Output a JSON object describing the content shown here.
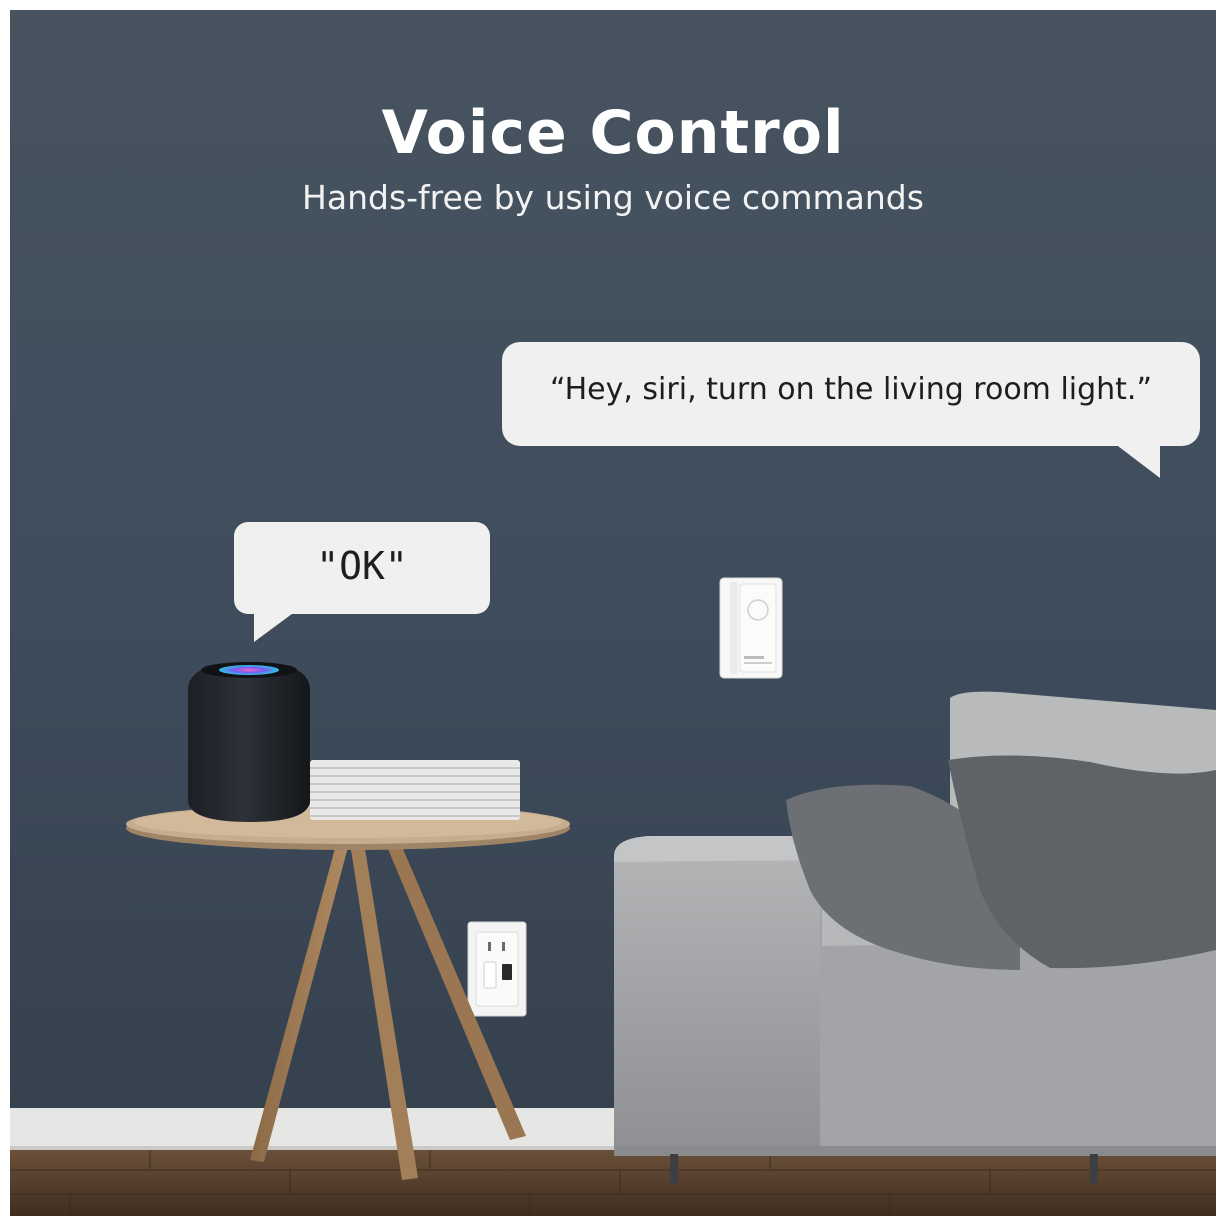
{
  "headline": {
    "title": "Voice Control",
    "subtitle": "Hands-free by using voice commands"
  },
  "speech_bubbles": {
    "user_command": "“Hey, siri, turn on the living room light.”",
    "speaker_reply": "\"OK\""
  },
  "colors": {
    "wall": "#3f4d5d",
    "floor": "#5c4432",
    "baseboard": "#e6e6e4",
    "sofa": "#a8a9ab",
    "bubble": "#f0f0f0",
    "title_text": "#ffffff"
  },
  "objects": [
    "smart-speaker",
    "side-table",
    "magazine-stack",
    "smart-wall-switch",
    "wall-outlet",
    "sofa",
    "throw-pillows"
  ]
}
